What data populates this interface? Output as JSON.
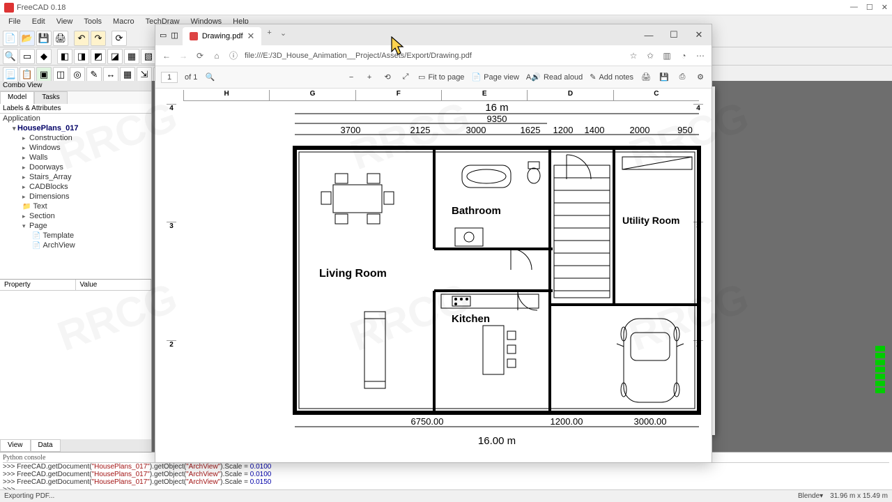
{
  "freecad": {
    "title": "FreeCAD 0.18",
    "menu": [
      "File",
      "Edit",
      "View",
      "Tools",
      "Macro",
      "TechDraw",
      "Windows",
      "Help"
    ],
    "combo": "Combo View",
    "tabs": {
      "model": "Model",
      "tasks": "Tasks"
    },
    "labels": "Labels & Attributes",
    "tree": {
      "app": "Application",
      "doc": "HousePlans_017",
      "items": [
        "Construction",
        "Windows",
        "Walls",
        "Doorways",
        "Stairs_Array",
        "CADBlocks",
        "Dimensions",
        "Text",
        "Section",
        "Page"
      ],
      "pagechildren": [
        "Template",
        "ArchView"
      ]
    },
    "prop": {
      "c1": "Property",
      "c2": "Value"
    },
    "bottabs": {
      "view": "View",
      "data": "Data"
    },
    "console": {
      "hdr": "Python console",
      "l1a": ">>> FreeCAD.getDocument(",
      "l1b": "\"HousePlans_017\"",
      "l1c": ").getObject(",
      "l1d": "\"ArchView\"",
      "l1e": ").Scale = ",
      "l1f": "0.0100",
      "l2f": "0.0100",
      "l3f": "0.0150",
      "prompt": ">>> "
    },
    "status": {
      "left": "Exporting PDF...",
      "wb": "Blende",
      "dim": "31.96 m x 15.49 m"
    }
  },
  "edge": {
    "tab": "Drawing.pdf",
    "url": "file:///E:/3D_House_Animation__Project/Assets/Export/Drawing.pdf",
    "page_cur": "1",
    "page_of": "of 1",
    "fit": "Fit to page",
    "pageview": "Page view",
    "readaloud": "Read aloud",
    "addnotes": "Add notes"
  },
  "plan": {
    "rulers_top": [
      "H",
      "G",
      "F",
      "E",
      "D",
      "C"
    ],
    "rulers_side": [
      "4",
      "3",
      "2"
    ],
    "rulers_right": [
      "4",
      "3",
      "2"
    ],
    "overall": "16 m",
    "dim_9350": "9350",
    "dims_top": [
      "3700",
      "2125",
      "3000",
      "1625",
      "1200",
      "1400",
      "2000",
      "950"
    ],
    "dims_bot": [
      "6750.00",
      "1200.00",
      "3000.00"
    ],
    "dim_bot_overall": "16.00 m",
    "rooms": {
      "living": "Living Room",
      "bath": "Bathroom",
      "kitchen": "Kitchen",
      "utility": "Utility Room"
    }
  },
  "watermark": "RRCG"
}
